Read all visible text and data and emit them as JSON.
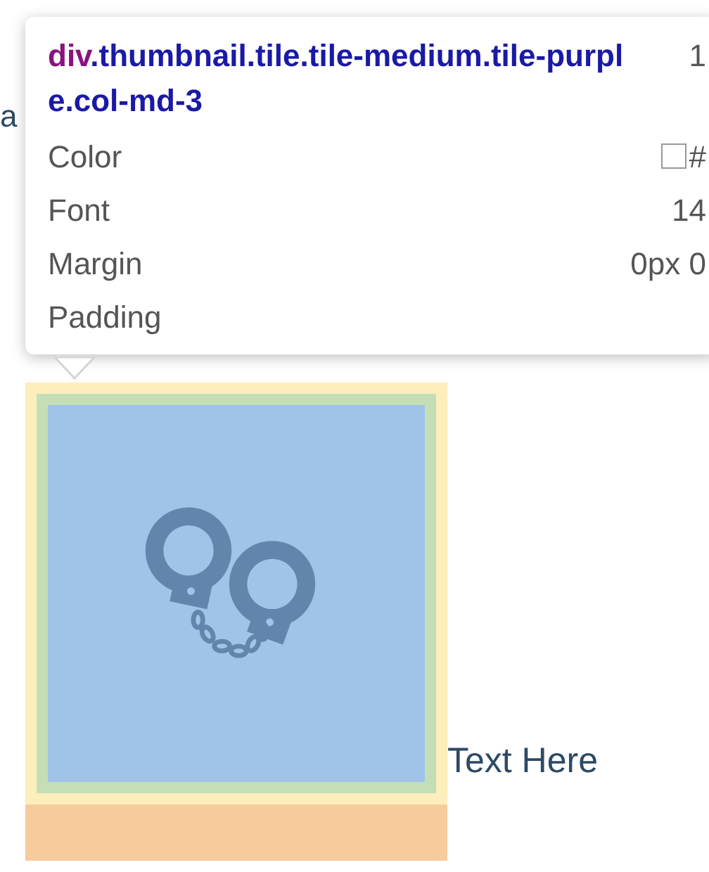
{
  "background_text": "a",
  "tooltip": {
    "tag": "div",
    "classes": ".thumbnail.tile.tile-medium.tile-purple.col-md-3",
    "size": "1",
    "rows": [
      {
        "label": "Color",
        "kind": "color",
        "value": "#"
      },
      {
        "label": "Font",
        "kind": "text",
        "value": "14"
      },
      {
        "label": "Margin",
        "kind": "text",
        "value": "0px 0"
      },
      {
        "label": "Padding",
        "kind": "text"
      }
    ]
  },
  "tile": {
    "caption": "Text Here"
  }
}
